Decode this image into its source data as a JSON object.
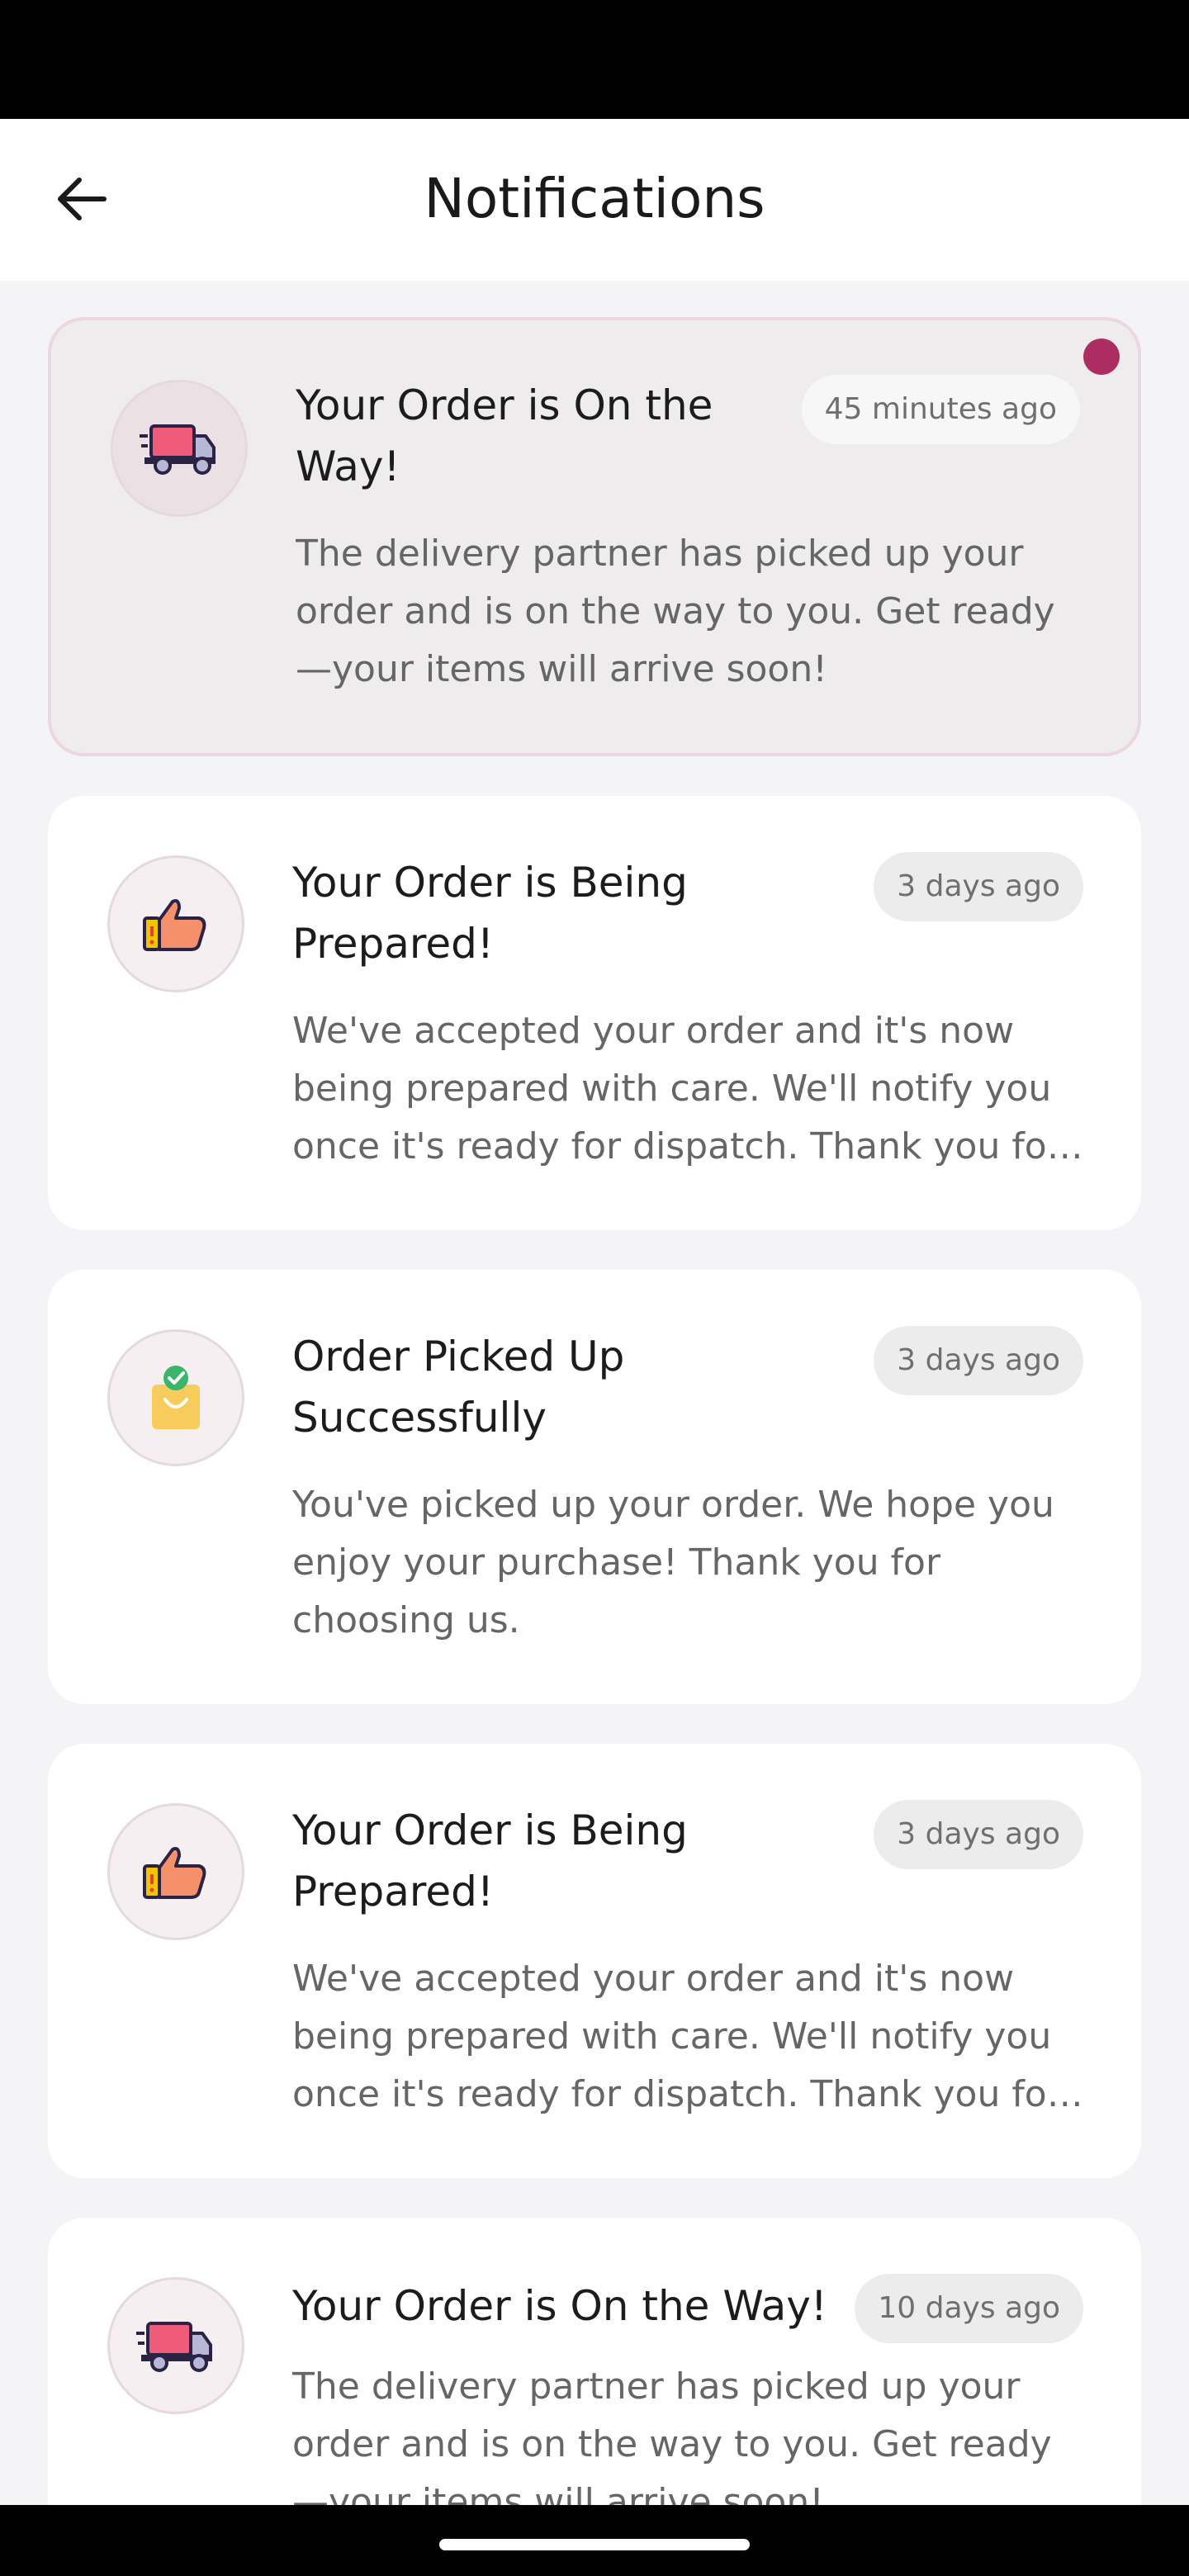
{
  "header": {
    "title": "Notifications"
  },
  "notifications": [
    {
      "title": "Your Order is On the Way!",
      "time": "45 minutes ago",
      "body": "The delivery partner has picked up your order and is on the way to you. Get ready—your items will arrive soon!",
      "icon": "delivery-truck-icon",
      "unread": true
    },
    {
      "title": "Your Order is Being Prepared!",
      "time": "3 days ago",
      "body": "We've accepted your order and it's now being prepared with care. We'll notify you once it's ready for dispatch. Thank you for ...",
      "icon": "thumbs-up-icon",
      "unread": false
    },
    {
      "title": "Order Picked Up Successfully",
      "time": "3 days ago",
      "body": "You've picked up your order. We hope you enjoy your purchase! Thank you for choosing us.",
      "icon": "shopping-bag-check-icon",
      "unread": false
    },
    {
      "title": "Your Order is Being Prepared!",
      "time": "3 days ago",
      "body": "We've accepted your order and it's now being prepared with care. We'll notify you once it's ready for dispatch. Thank you for ...",
      "icon": "thumbs-up-icon",
      "unread": false
    },
    {
      "title": "Your Order is On the Way!",
      "time": "10 days ago",
      "body": "The delivery partner has picked up your order and is on the way to you. Get ready—your items will arrive soon!",
      "icon": "delivery-truck-icon",
      "unread": false
    }
  ],
  "colors": {
    "accent": "#ad2c62",
    "unread_background": "#eeeced",
    "page_background": "#f4f3f5"
  }
}
